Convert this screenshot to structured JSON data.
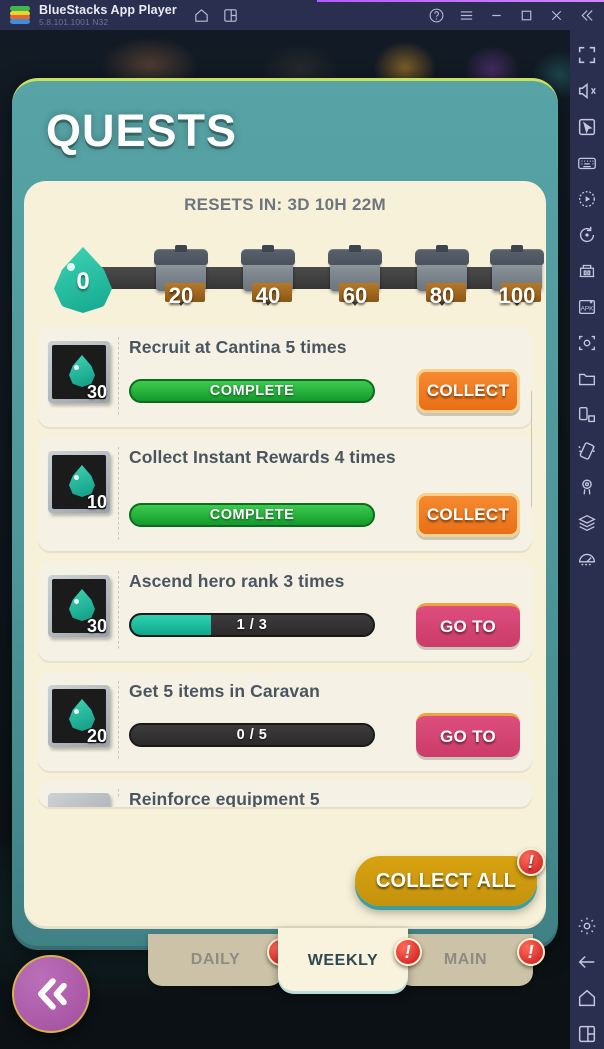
{
  "titlebar": {
    "app_title": "BlueStacks App Player",
    "version": "5.8.101.1001  N32",
    "icons_left": [
      "home-icon",
      "multi-instance-icon"
    ],
    "icons_right": [
      "help-icon",
      "menu-icon",
      "minimize-icon",
      "maximize-icon",
      "close-icon",
      "collapse-icon"
    ]
  },
  "sidebar": {
    "icons": [
      "fullscreen-icon",
      "mute-icon",
      "pointer-icon",
      "keyboard-icon",
      "macro-recorder-icon",
      "sync-icon",
      "multi-instance-manager-icon",
      "install-apk-icon",
      "screenshot-icon",
      "media-folder-icon",
      "rotate-icon",
      "shake-icon",
      "location-icon",
      "layers-icon",
      "eco-mode-icon"
    ],
    "bottom_icons": [
      "settings-icon",
      "back-icon",
      "home-icon",
      "recents-icon"
    ]
  },
  "quests": {
    "title": "QUESTS",
    "resets_label": "RESETS IN: 3D 10H 22M",
    "track": {
      "current_points": "0",
      "milestones": [
        "20",
        "40",
        "60",
        "80",
        "100"
      ]
    },
    "items": [
      {
        "reward_amount": "30",
        "reward_icon": "energy-drop-icon",
        "text": "Recruit at Cantina 5 times",
        "progress_label": "COMPLETE",
        "progress_pct": 100,
        "state": "complete",
        "action_label": "COLLECT",
        "action_type": "collect"
      },
      {
        "reward_amount": "10",
        "reward_icon": "energy-drop-icon",
        "text": "Collect Instant Rewards 4 times",
        "progress_label": "COMPLETE",
        "progress_pct": 100,
        "state": "complete",
        "action_label": "COLLECT",
        "action_type": "collect"
      },
      {
        "reward_amount": "30",
        "reward_icon": "energy-drop-icon",
        "text": "Ascend hero rank 3 times",
        "progress_label": "1 / 3",
        "progress_pct": 33,
        "state": "in-progress",
        "action_label": "GO TO",
        "action_type": "goto"
      },
      {
        "reward_amount": "20",
        "reward_icon": "energy-drop-icon",
        "text": "Get 5 items in Caravan",
        "progress_label": "0 / 5",
        "progress_pct": 0,
        "state": "in-progress",
        "action_label": "GO TO",
        "action_type": "goto"
      },
      {
        "reward_amount": "",
        "reward_icon": "energy-drop-icon",
        "text": "Reinforce equipment 5",
        "progress_label": "",
        "progress_pct": 0,
        "state": "partial",
        "action_label": "",
        "action_type": ""
      }
    ],
    "collect_all_label": "COLLECT ALL",
    "collect_all_badge": "!"
  },
  "tabs": [
    {
      "label": "DAILY",
      "active": false,
      "badge": "!"
    },
    {
      "label": "WEEKLY",
      "active": true,
      "badge": "!"
    },
    {
      "label": "MAIN",
      "active": false,
      "badge": "!"
    }
  ],
  "back_button": {
    "icon": "double-chevron-left-icon"
  },
  "colors": {
    "panel_teal": "#4d9699",
    "panel_cream": "#f8f1d9",
    "accent_lime": "#c9e05a",
    "collect_orange": "#ea6f16",
    "goto_pink": "#cc3b69",
    "collect_all_gold": "#c4920c",
    "progress_teal": "#0fa98c",
    "progress_green": "#139a2b",
    "badge_red": "#c8171b",
    "sidebar_navy": "#2a2f50",
    "back_button_purple": "#a24e9e"
  }
}
